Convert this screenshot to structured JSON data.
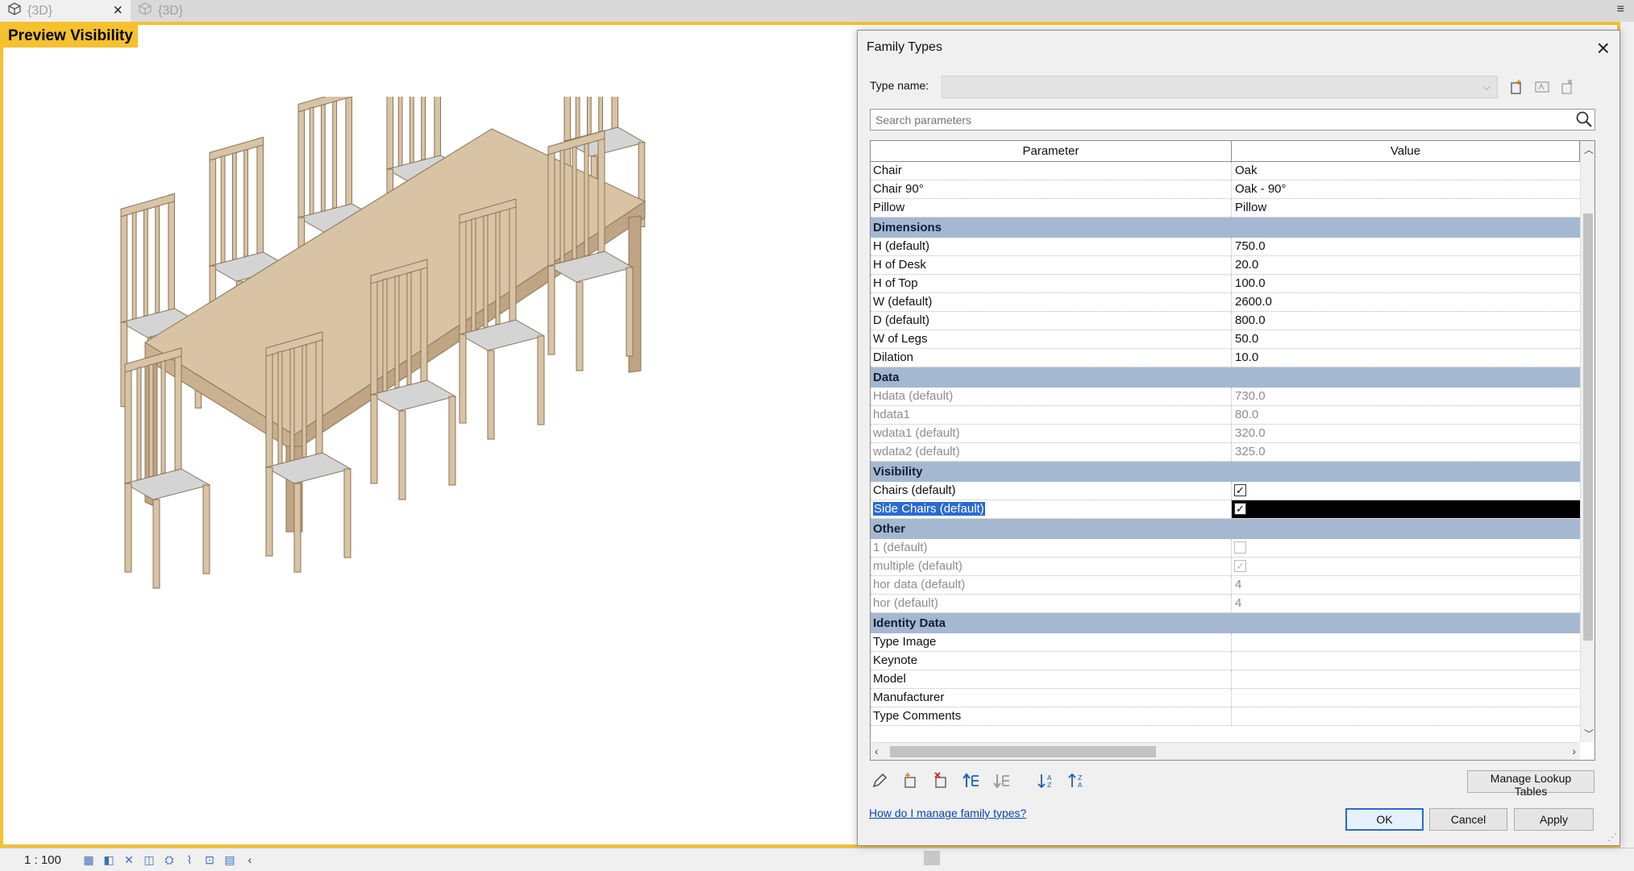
{
  "tabs": [
    {
      "label": "{3D}",
      "close_glyph": "×",
      "active": true
    },
    {
      "label": "{3D}",
      "active": false
    }
  ],
  "tab_menu_glyph": "≡",
  "viewport": {
    "label": "Preview Visibility"
  },
  "status": {
    "scale": "1 : 100"
  },
  "dialog": {
    "title": "Family Types",
    "close_glyph": "×",
    "type_name_label": "Type name:",
    "search_placeholder": "Search parameters",
    "col_parameter": "Parameter",
    "col_value": "Value",
    "rows": [
      {
        "kind": "param",
        "p": "Chair",
        "v": "Oak"
      },
      {
        "kind": "param",
        "p": "Chair 90°",
        "v": "Oak - 90°"
      },
      {
        "kind": "param",
        "p": "Pillow",
        "v": "Pillow"
      },
      {
        "kind": "group",
        "p": "Dimensions"
      },
      {
        "kind": "param",
        "p": "H (default)",
        "v": "750.0"
      },
      {
        "kind": "param",
        "p": "H of Desk",
        "v": "20.0"
      },
      {
        "kind": "param",
        "p": "H of Top",
        "v": "100.0"
      },
      {
        "kind": "param",
        "p": "W (default)",
        "v": "2600.0"
      },
      {
        "kind": "param",
        "p": "D (default)",
        "v": "800.0"
      },
      {
        "kind": "param",
        "p": "W of Legs",
        "v": "50.0"
      },
      {
        "kind": "param",
        "p": "Dilation",
        "v": "10.0"
      },
      {
        "kind": "group",
        "p": "Data"
      },
      {
        "kind": "gray",
        "p": "Hdata (default)",
        "v": "730.0"
      },
      {
        "kind": "gray",
        "p": "hdata1",
        "v": "80.0"
      },
      {
        "kind": "gray",
        "p": "wdata1 (default)",
        "v": "320.0"
      },
      {
        "kind": "gray",
        "p": "wdata2 (default)",
        "v": "325.0"
      },
      {
        "kind": "group",
        "p": "Visibility"
      },
      {
        "kind": "check",
        "p": "Chairs (default)",
        "checked": true
      },
      {
        "kind": "check-sel",
        "p": "Side Chairs (default)",
        "checked": true
      },
      {
        "kind": "group",
        "p": "Other"
      },
      {
        "kind": "check-dis",
        "p": "1 (default)",
        "checked": false
      },
      {
        "kind": "check-dis",
        "p": "multiple (default)",
        "checked": true
      },
      {
        "kind": "gray",
        "p": "hor data (default)",
        "v": "4"
      },
      {
        "kind": "gray",
        "p": "hor (default)",
        "v": "4"
      },
      {
        "kind": "group",
        "p": "Identity Data"
      },
      {
        "kind": "param",
        "p": "Type Image",
        "v": ""
      },
      {
        "kind": "param",
        "p": "Keynote",
        "v": ""
      },
      {
        "kind": "param",
        "p": "Model",
        "v": ""
      },
      {
        "kind": "param",
        "p": "Manufacturer",
        "v": ""
      },
      {
        "kind": "param",
        "p": "Type Comments",
        "v": ""
      }
    ],
    "manage_lookup_tables": "Manage Lookup Tables",
    "help_link": "How do I manage family types?",
    "ok": "OK",
    "cancel": "Cancel",
    "apply": "Apply"
  },
  "colors": {
    "accent_yellow": "#f5c12e",
    "group_header": "#a5b8d1",
    "selection_blue": "#2a6ad2",
    "link_blue": "#0b45b5",
    "wood": "#d8c3a5",
    "cushion": "#d4d4d4"
  },
  "icons": {
    "tab": "cube-icon",
    "search": "magnifier-icon",
    "toolbar": [
      "pencil-icon",
      "new-parameter-icon",
      "delete-parameter-icon",
      "move-up-icon",
      "move-down-icon",
      "sort-ascending-icon",
      "sort-descending-icon"
    ]
  }
}
